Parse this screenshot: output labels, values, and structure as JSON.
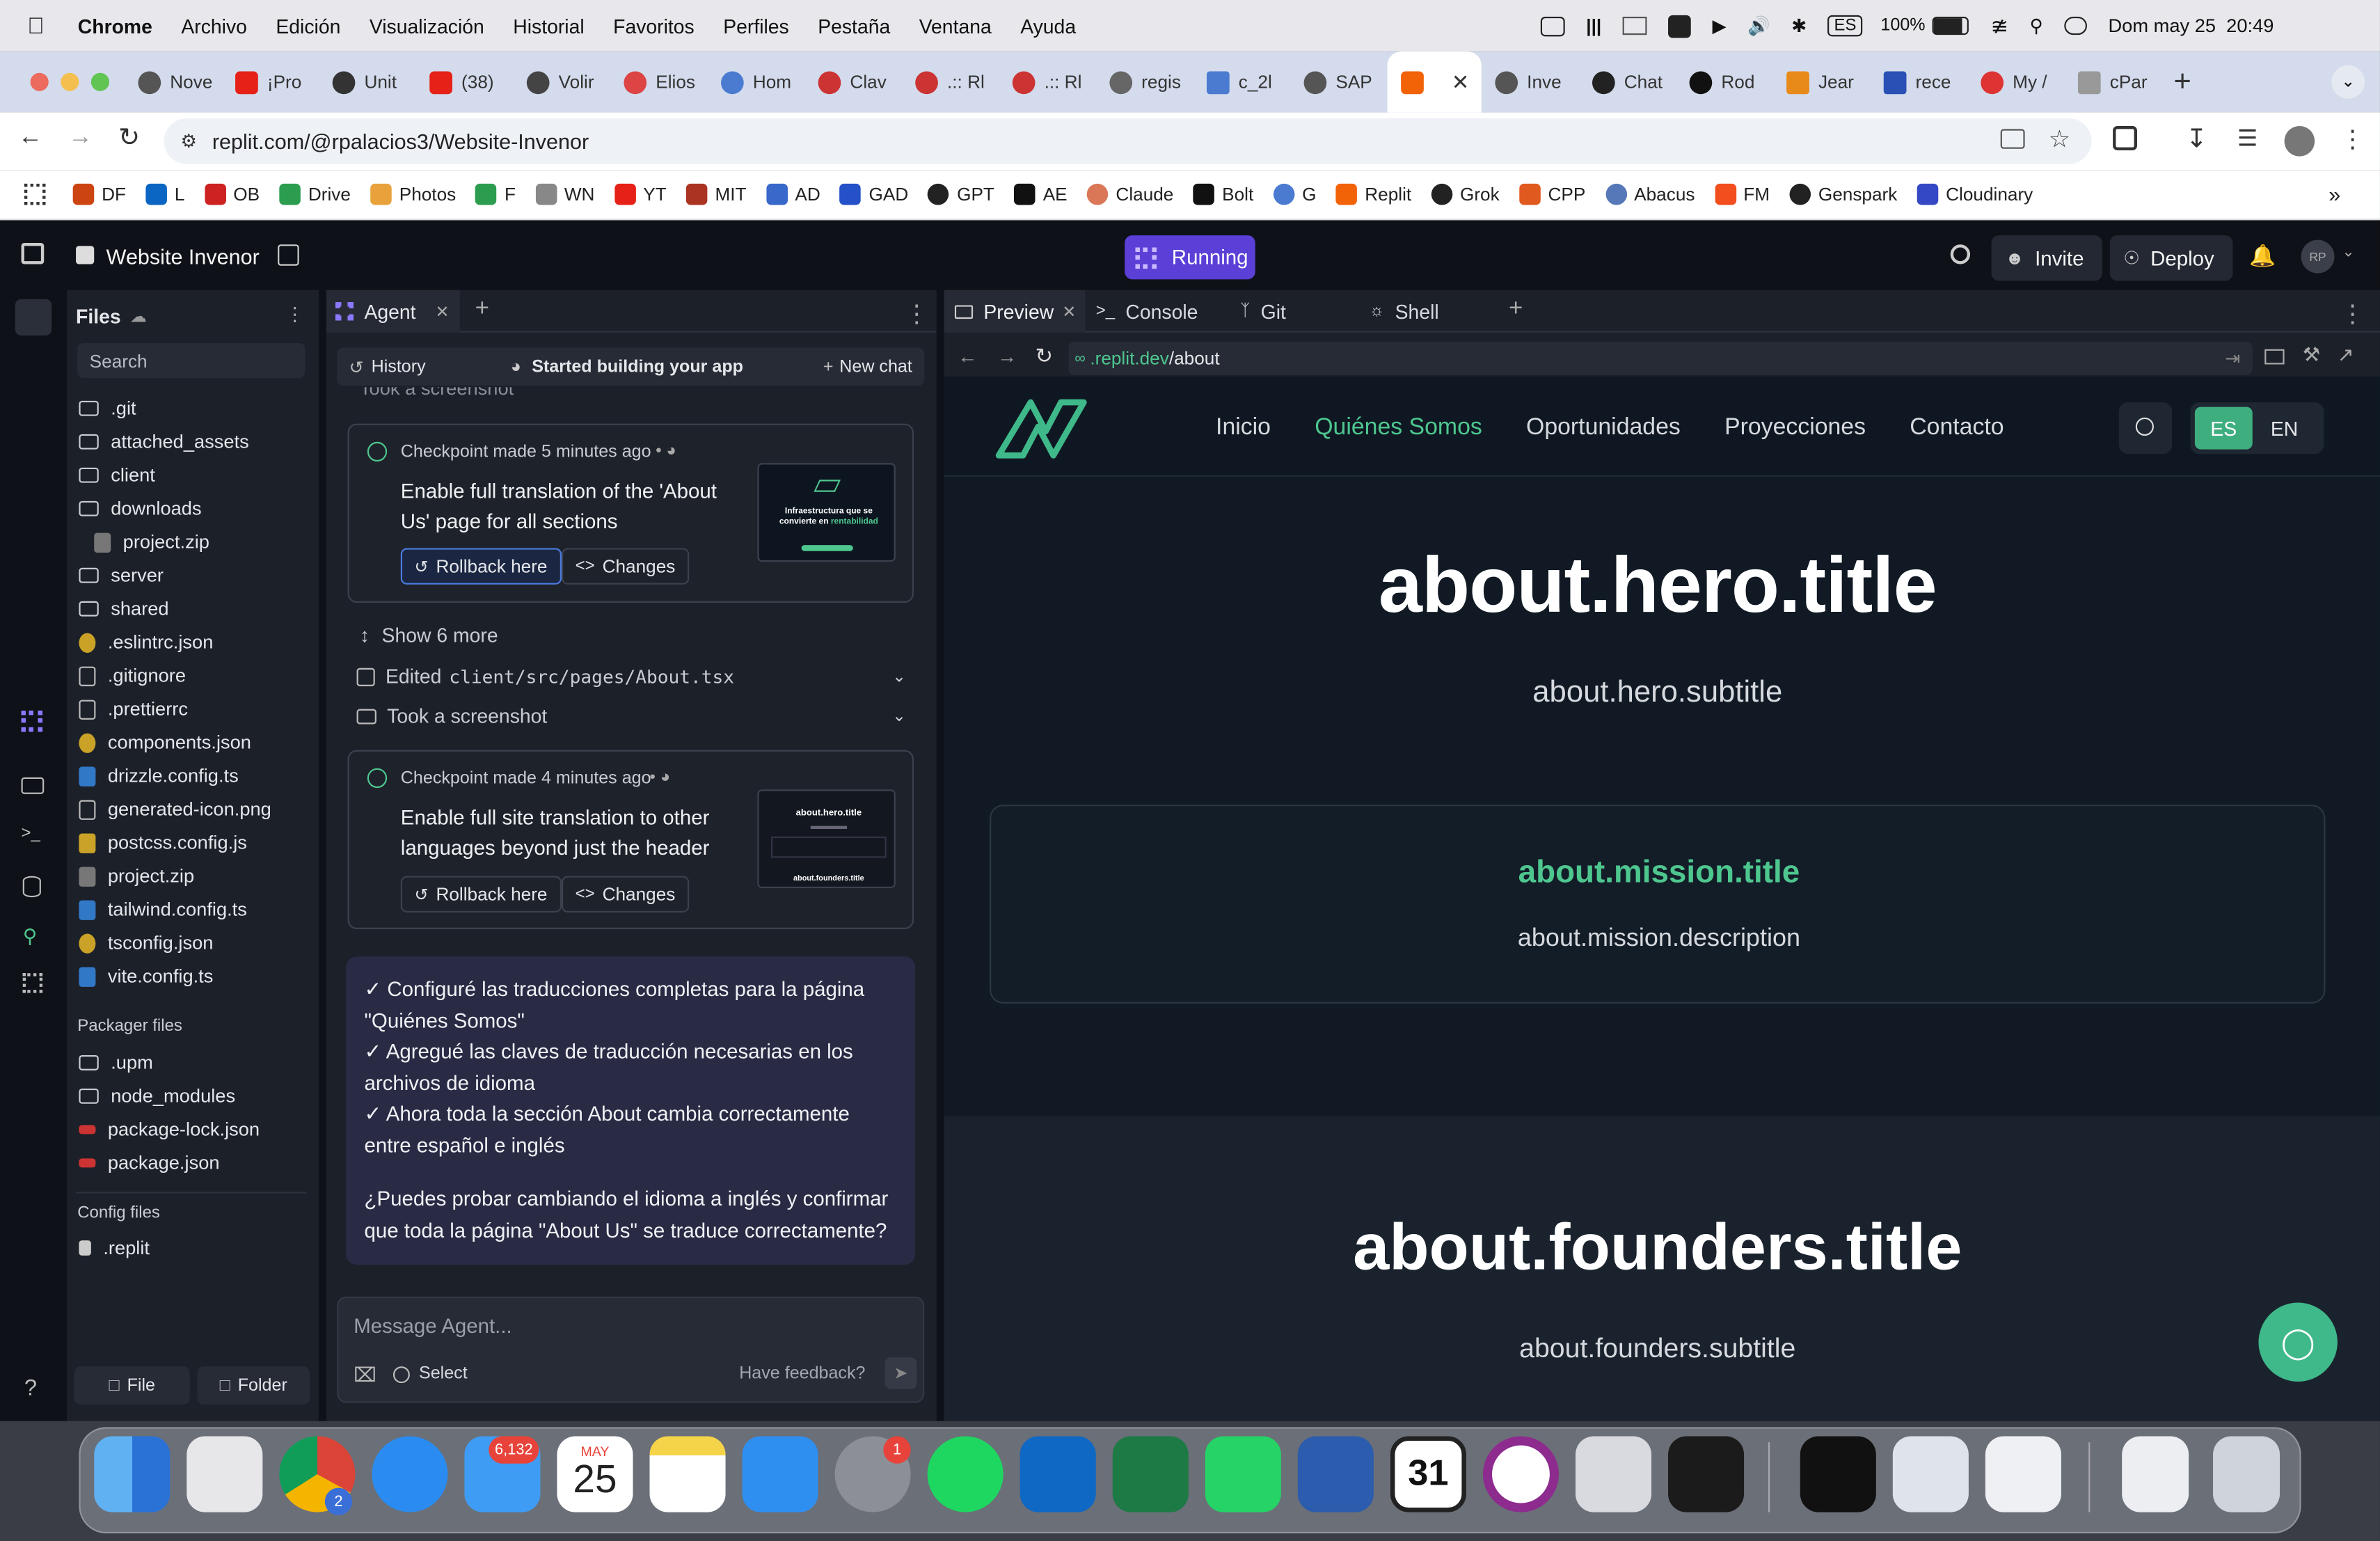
{
  "menubar": {
    "app": "Chrome",
    "items": [
      "Archivo",
      "Edición",
      "Visualización",
      "Historial",
      "Favoritos",
      "Perfiles",
      "Pestaña",
      "Ventana",
      "Ayuda"
    ],
    "lang": "ES",
    "battery": "100%",
    "datetime": "Dom may 25  20:49"
  },
  "tabs": [
    "Nove",
    "¡Pro",
    "Unit",
    "(38)",
    "Volir",
    "Elios",
    "Hom",
    "Clav",
    ".:: Rl",
    ".:: Rl",
    "regis",
    "c_2l",
    "SAP",
    "",
    "Inve",
    "Chat",
    "Rod",
    "Jear",
    "rece",
    "My /",
    "cPar"
  ],
  "address": {
    "url": "replit.com/@rpalacios3/Website-Invenor"
  },
  "bookmarks": [
    "DF",
    "L",
    "OB",
    "Drive",
    "Photos",
    "F",
    "WN",
    "YT",
    "MIT",
    "AD",
    "GAD",
    "GPT",
    "AE",
    "Claude",
    "Bolt",
    "G",
    "Replit",
    "Grok",
    "CPP",
    "Abacus",
    "FM",
    "Genspark",
    "Cloudinary"
  ],
  "replit": {
    "project": "Website Invenor",
    "status": "Running",
    "invite": "Invite",
    "deploy": "Deploy",
    "avatar": "RP",
    "files": {
      "title": "Files",
      "search": "Search",
      "items": [
        ".git",
        "attached_assets",
        "client",
        "downloads",
        "project.zip",
        "server",
        "shared",
        ".eslintrc.json",
        ".gitignore",
        ".prettierrc",
        "components.json",
        "drizzle.config.ts",
        "generated-icon.png",
        "postcss.config.js",
        "project.zip",
        "tailwind.config.ts",
        "tsconfig.json",
        "vite.config.ts"
      ],
      "packager_title": "Packager files",
      "packager": [
        ".upm",
        "node_modules",
        "package-lock.json",
        "package.json"
      ],
      "config_title": "Config files",
      "config": [
        ".replit"
      ],
      "file_btn": "File",
      "folder_btn": "Folder"
    },
    "agent": {
      "tab": "Agent",
      "history": "History",
      "started": "Started building your app",
      "new_chat": "New chat",
      "took_screenshot_top": "Took a screenshot",
      "cp1": {
        "meta": "Checkpoint made 5 minutes ago",
        "title": "Enable full translation of the 'About Us' page for all sections",
        "rollback": "Rollback here",
        "changes": "Changes",
        "thumb_line1": "Infraestructura que se",
        "thumb_line2": "convierte en",
        "thumb_accent": "rentabilidad"
      },
      "show_more": "Show 6 more",
      "edited_prefix": "Edited",
      "edited_file": "client/src/pages/About.tsx",
      "took_screenshot": "Took a screenshot",
      "cp2": {
        "meta": "Checkpoint made 4 minutes ago",
        "title": "Enable full site translation to other languages beyond just the header",
        "rollback": "Rollback here",
        "changes": "Changes",
        "thumb_line1": "about.hero.title",
        "thumb_line2": "about.founders.title"
      },
      "message": {
        "l1": "✓ Configuré las traducciones completas para la página \"Quiénes Somos\"",
        "l2": "✓ Agregué las claves de traducción necesarias en los archivos de idioma",
        "l3": "✓ Ahora toda la sección About cambia correctamente entre español e inglés",
        "q": "¿Puedes probar cambiando el idioma a inglés y confirmar que toda la página \"About Us\" se traduce correctamente?"
      },
      "input_placeholder": "Message Agent...",
      "select": "Select",
      "feedback": "Have feedback?"
    },
    "preview": {
      "tabs": [
        "Preview",
        "Console",
        "Git",
        "Shell"
      ],
      "url_prefix": ".replit.dev",
      "url_path": "/about"
    }
  },
  "site": {
    "nav": [
      "Inicio",
      "Quiénes Somos",
      "Oportunidades",
      "Proyecciones",
      "Contacto"
    ],
    "lang_es": "ES",
    "lang_en": "EN",
    "hero_title": "about.hero.title",
    "hero_subtitle": "about.hero.subtitle",
    "mission_title": "about.mission.title",
    "mission_desc": "about.mission.description",
    "founders_title": "about.founders.title",
    "founders_subtitle": "about.founders.subtitle"
  },
  "dock": {
    "mail_badge": "6,132",
    "cal_month": "MAY",
    "cal_day": "25",
    "settings_badge": "1",
    "chrome_badge": "2",
    "cal2_day": "31"
  },
  "colors": {
    "accent": "#4ec78f",
    "purple": "#6f55e6",
    "bg": "#0e1117"
  }
}
